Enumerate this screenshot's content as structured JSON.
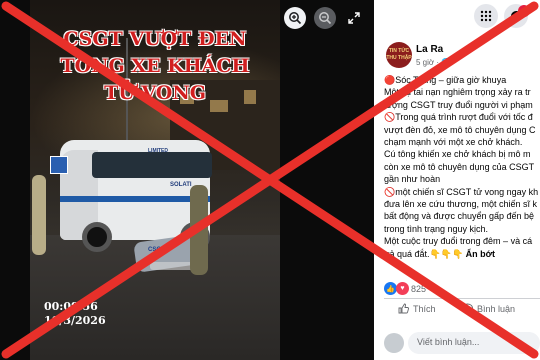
{
  "photo": {
    "headline_line1": "CSGT VƯỢT ĐEN",
    "headline_line2": "TÔNG XE KHÁCH",
    "headline_line3": "TỬ VONG",
    "time_stamp": "00:09.56",
    "date_stamp": "10/3/2026",
    "van_brand": "LIMITED",
    "van_plate_text": "SOLATI",
    "bike_text": "CSGT"
  },
  "viewer_controls": {
    "zoom_in_icon": "zoom-in-icon",
    "zoom_out_icon": "zoom-out-icon",
    "expand_icon": "expand-icon"
  },
  "post": {
    "author": "La Ra",
    "time": "5 giờ",
    "avatar_text": "TIN TỨC THU THẬP",
    "lines": [
      "🔴Sóc Trăng – giữa giờ khuya",
      "Một vụ tai nạn nghiêm trọng xảy ra tr",
      "lượng CSGT truy đuổi người vi phạm ",
      "🚫Trong quá trình rượt đuổi với tốc đ",
      "vượt đèn đỏ, xe mô tô chuyên dụng C",
      "chạm mạnh với một xe chở khách.",
      "Cú tông khiến xe chở khách bị mô m",
      "còn xe mô tô chuyên dụng của CSGT",
      "gần như hoàn",
      "🚫một chiến sĩ CSGT tử vong ngay kh",
      "đưa lên xe cứu thương, một chiến sĩ k",
      "bất động và được chuyển gấp đến bệ",
      "trong tình trạng nguy kịch.",
      "Một cuộc truy đuổi trong đêm – và cá",
      "trả quá đắt.👇👇👇"
    ],
    "see_less": "Ẩn bớt",
    "reaction_count": "825",
    "like_label": "Thích",
    "comment_label": "Bình luận",
    "comment_placeholder": "Viết bình luận..."
  },
  "colors": {
    "overlay_red": "#e8302a",
    "headline_red": "#d11f1f",
    "fb_blue": "#1877f2"
  }
}
